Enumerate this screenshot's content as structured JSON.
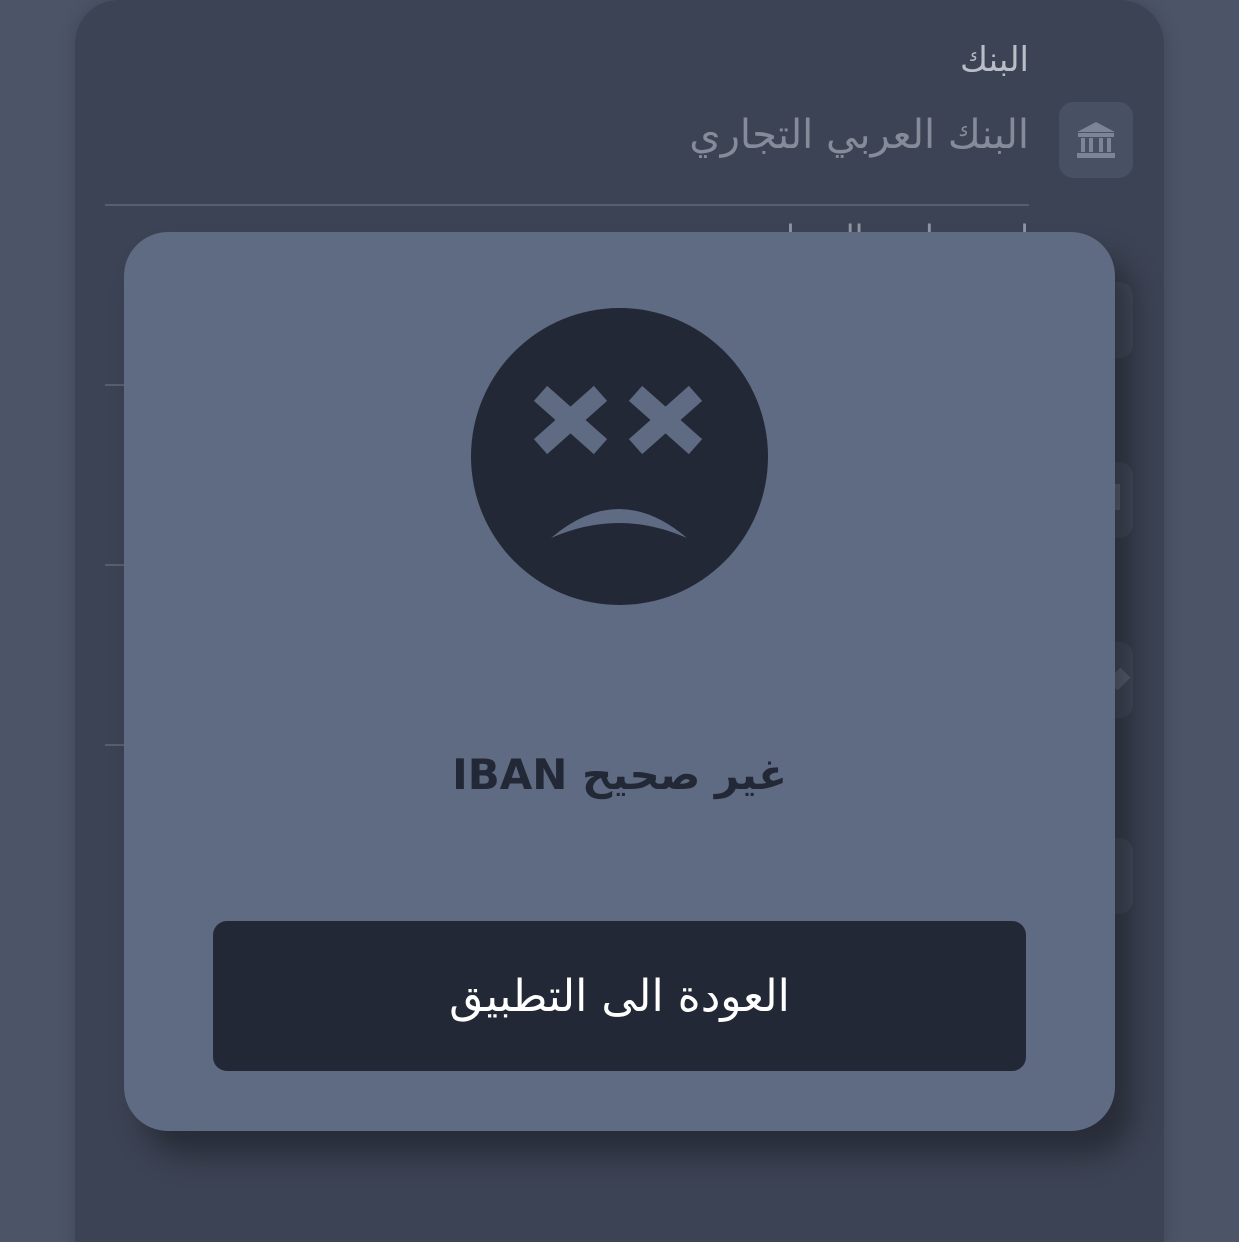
{
  "background_form": {
    "bank_field": {
      "label": "البنك",
      "value": "البنك العربي التجاري",
      "icon": "bank-icon"
    },
    "next_field_label": "اسم صاحب الحساب"
  },
  "dialog": {
    "icon": "sad-face-x-eyes-icon",
    "message": "IBAN غير صحيح",
    "button_label": "العودة الى التطبيق"
  },
  "colors": {
    "page_background": "#4c5568",
    "sheet_background": "#3c4354",
    "dialog_background": "#5f6b82",
    "dark_accent": "#222836",
    "button_text": "#ffffff"
  }
}
